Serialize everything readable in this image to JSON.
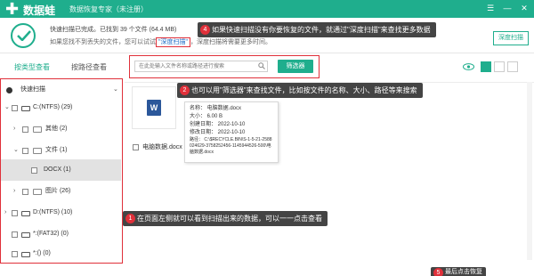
{
  "window": {
    "title": "数据蛙",
    "subtitle": "数据恢复专家（未注册）",
    "controls": [
      "☰",
      "—",
      "✕"
    ]
  },
  "status": {
    "line1": "快速扫描已完成。已找到 39 个文件 (64.4 MB)",
    "line2_prefix": "如果您找不到丢失的文件，您可以试试",
    "deep_scan_link": "\"深度扫描\"",
    "line2_suffix": "，深度扫描将需要更多时间。",
    "deep_scan_button": "深度扫描"
  },
  "tabs": {
    "by_type": "按类型查看",
    "by_path": "按路径查看"
  },
  "tree": {
    "items": [
      {
        "label": "快速扫描"
      },
      {
        "label": "C:(NTFS) (29)"
      },
      {
        "label": "其他 (2)"
      },
      {
        "label": "文件 (1)"
      },
      {
        "label": "DOCX (1)"
      },
      {
        "label": "图片 (26)"
      },
      {
        "label": "D:(NTFS) (10)"
      },
      {
        "label": "*:(FAT32) (0)"
      },
      {
        "label": "*:() (0)"
      }
    ]
  },
  "search": {
    "placeholder": "在此处输入文件名称或路径进行搜索",
    "filter_button": "筛选器"
  },
  "file": {
    "name": "电脑数据.docx",
    "word_icon": "W"
  },
  "tooltip": {
    "name": "名称：  电脑数据.docx",
    "size": "大小：  6.00 B",
    "created": "创建日期：  2022-10-10",
    "modified": "修改日期：  2022-10-10",
    "path": "路径：  C:\\$RECYCLE.BIN\\S-1-5-21-2588024629-3758252456-1145944526-500\\电脑数据.docx"
  },
  "annotations": {
    "a4_num": "4",
    "a4_text": "如果快速扫描没有你要恢复的文件，就通过\"深度扫描\"来查找更多数据",
    "a2_num": "2",
    "a2_text": "也可以用\"筛选器\"来查找文件，比如按文件的名称、大小、路径等来搜索",
    "a1_num": "1",
    "a1_text": "在页面左侧就可以看到扫描出来的数据，可以一一点击查看",
    "a5_num": "5",
    "a5_text": "最后点击恢复"
  },
  "colors": {
    "brand": "#1fae8d",
    "highlight": "#e0303a",
    "annotation_bg": "#444444"
  }
}
